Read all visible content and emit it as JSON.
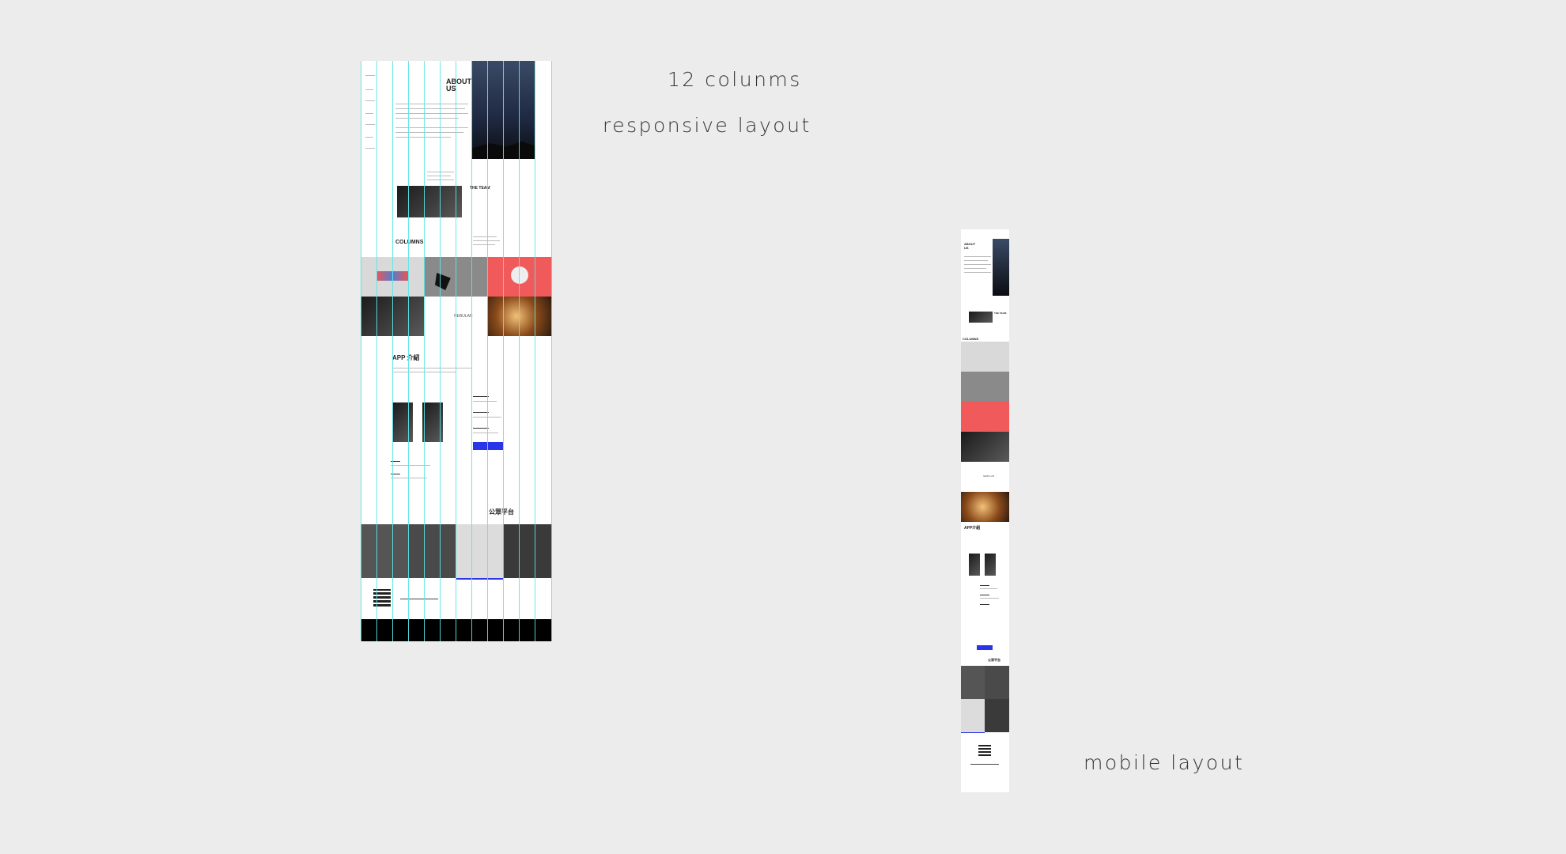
{
  "captions": {
    "columns": "12 colunms",
    "responsive": "responsive layout",
    "mobile": "mobile layout"
  },
  "desktop": {
    "about_title": "ABOUT US",
    "team_title": "THE TEAM",
    "columns_title": "COLUMNS",
    "nebular_label": "NEBULAR",
    "app_title": "APP 介紹",
    "public_title": "公眾平台",
    "grid_columns": 12,
    "colors": {
      "grid": "#5fe3e8",
      "accent_red": "#f05a5a",
      "accent_blue": "#2b35e8",
      "footer": "#000000"
    }
  },
  "mobile": {
    "about_title": "ABOUT US",
    "team_title": "THE TEAM",
    "columns_title": "COLUMNS",
    "nebular_label": "NEBULAR",
    "app_title": "APP介紹",
    "public_title": "公眾平台"
  }
}
